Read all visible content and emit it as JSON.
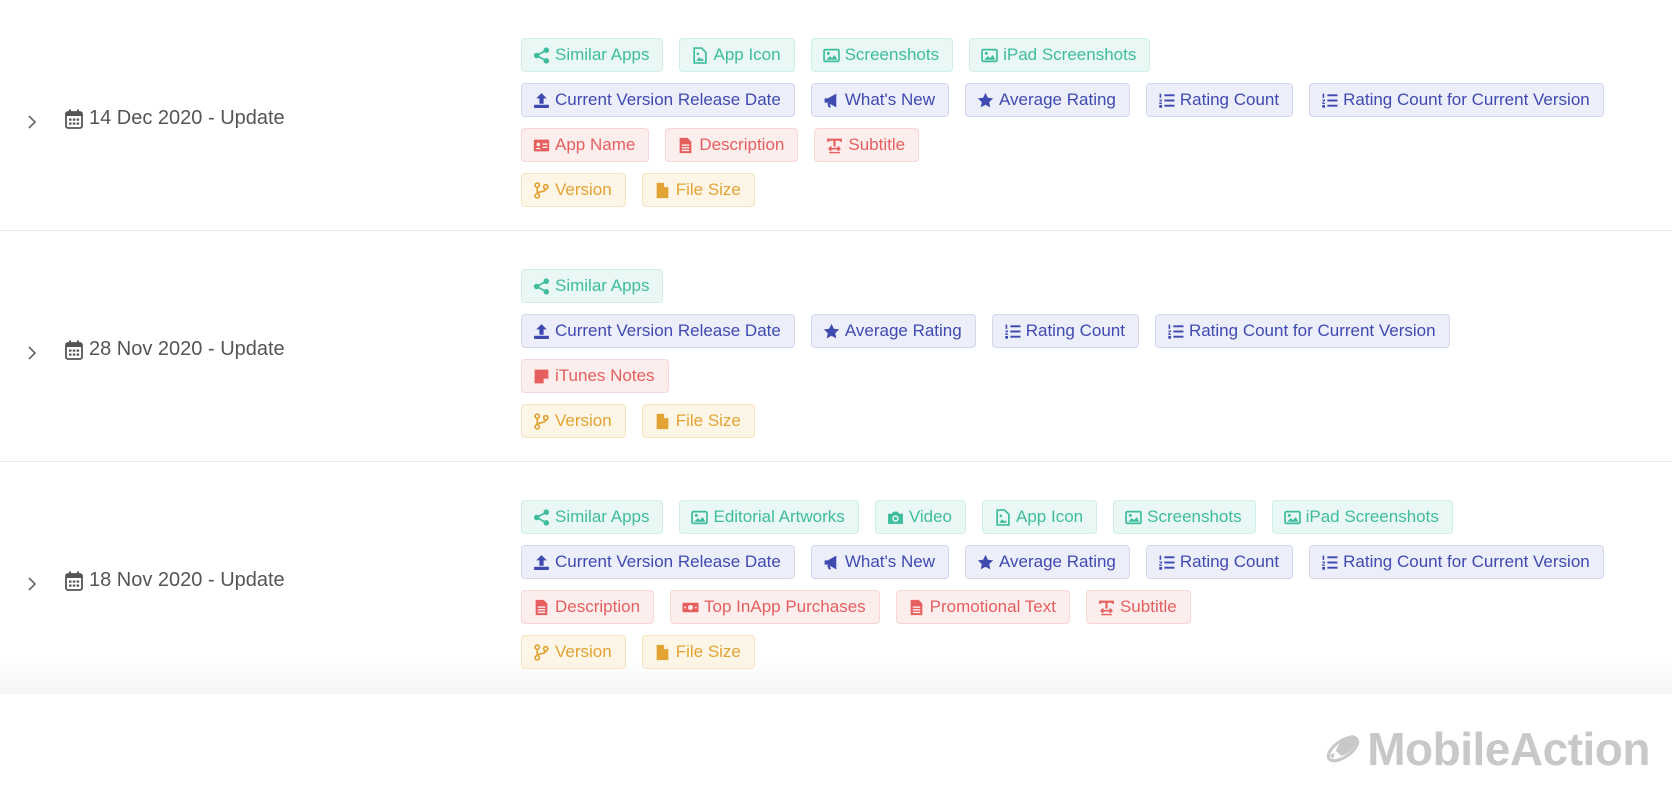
{
  "updates": [
    {
      "date_label": "14 Dec 2020 - Update",
      "groups": [
        [
          {
            "label": "Similar Apps",
            "icon": "share-icon"
          },
          {
            "label": "App Icon",
            "icon": "file-image-icon"
          },
          {
            "label": "Screenshots",
            "icon": "image-icon"
          },
          {
            "label": "iPad Screenshots",
            "icon": "image-icon"
          }
        ],
        [
          {
            "label": "Current Version Release Date",
            "icon": "upload-icon"
          },
          {
            "label": "What's New",
            "icon": "megaphone-icon"
          },
          {
            "label": "Average Rating",
            "icon": "star-icon"
          },
          {
            "label": "Rating Count",
            "icon": "list-ol-icon"
          },
          {
            "label": "Rating Count for Current Version",
            "icon": "list-ol-icon"
          }
        ],
        [
          {
            "label": "App Name",
            "icon": "id-card-icon"
          },
          {
            "label": "Description",
            "icon": "file-text-icon"
          },
          {
            "label": "Subtitle",
            "icon": "text-height-icon"
          }
        ],
        [
          {
            "label": "Version",
            "icon": "code-branch-icon"
          },
          {
            "label": "File Size",
            "icon": "file-icon"
          }
        ]
      ]
    },
    {
      "date_label": "28 Nov 2020 - Update",
      "groups": [
        [
          {
            "label": "Similar Apps",
            "icon": "share-icon"
          }
        ],
        [
          {
            "label": "Current Version Release Date",
            "icon": "upload-icon"
          },
          {
            "label": "Average Rating",
            "icon": "star-icon"
          },
          {
            "label": "Rating Count",
            "icon": "list-ol-icon"
          },
          {
            "label": "Rating Count for Current Version",
            "icon": "list-ol-icon"
          }
        ],
        [
          {
            "label": "iTunes Notes",
            "icon": "sticky-note-icon"
          }
        ],
        [
          {
            "label": "Version",
            "icon": "code-branch-icon"
          },
          {
            "label": "File Size",
            "icon": "file-icon"
          }
        ]
      ]
    },
    {
      "date_label": "18 Nov 2020 - Update",
      "groups": [
        [
          {
            "label": "Similar Apps",
            "icon": "share-icon"
          },
          {
            "label": "Editorial Artworks",
            "icon": "image-icon"
          },
          {
            "label": "Video",
            "icon": "camera-icon"
          },
          {
            "label": "App Icon",
            "icon": "file-image-icon"
          },
          {
            "label": "Screenshots",
            "icon": "image-icon"
          },
          {
            "label": "iPad Screenshots",
            "icon": "image-icon"
          }
        ],
        [
          {
            "label": "Current Version Release Date",
            "icon": "upload-icon"
          },
          {
            "label": "What's New",
            "icon": "megaphone-icon"
          },
          {
            "label": "Average Rating",
            "icon": "star-icon"
          },
          {
            "label": "Rating Count",
            "icon": "list-ol-icon"
          },
          {
            "label": "Rating Count for Current Version",
            "icon": "list-ol-icon"
          }
        ],
        [
          {
            "label": "Description",
            "icon": "file-text-icon"
          },
          {
            "label": "Top InApp Purchases",
            "icon": "money-bill-icon"
          },
          {
            "label": "Promotional Text",
            "icon": "file-text-icon"
          },
          {
            "label": "Subtitle",
            "icon": "text-height-icon"
          }
        ],
        [
          {
            "label": "Version",
            "icon": "code-branch-icon"
          },
          {
            "label": "File Size",
            "icon": "file-icon"
          }
        ]
      ]
    }
  ],
  "group_colors": {
    "teal": "#3fbc9e",
    "blue": "#3f4ab1",
    "red": "#e55f5f",
    "amber": "#e2a334"
  },
  "brand": {
    "name": "MobileAction",
    "icon": "rocket-logo-icon"
  }
}
